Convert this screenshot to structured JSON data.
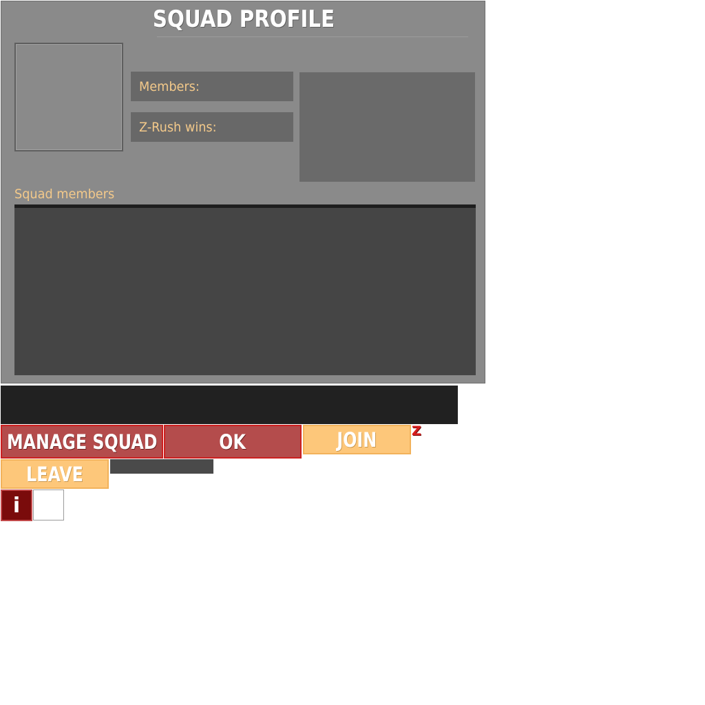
{
  "profile": {
    "title": "SQUAD PROFILE",
    "members_label": "Members:",
    "zrush_label": "Z-Rush wins:",
    "squad_members_label": "Squad members"
  },
  "buttons": {
    "manage_squad": "MANAGE SQUAD",
    "ok": "OK",
    "join": "JOIN",
    "leave": "LEAVE",
    "info": "i"
  },
  "badge": {
    "z": "Z"
  },
  "colors": {
    "panel_bg": "#8a8a8a",
    "accent_label": "#f3c98a",
    "red_button": "#b44c4c",
    "red_border": "#cc1f1f",
    "orange_button": "#fdc77a",
    "info_button": "#7a0b0b"
  }
}
